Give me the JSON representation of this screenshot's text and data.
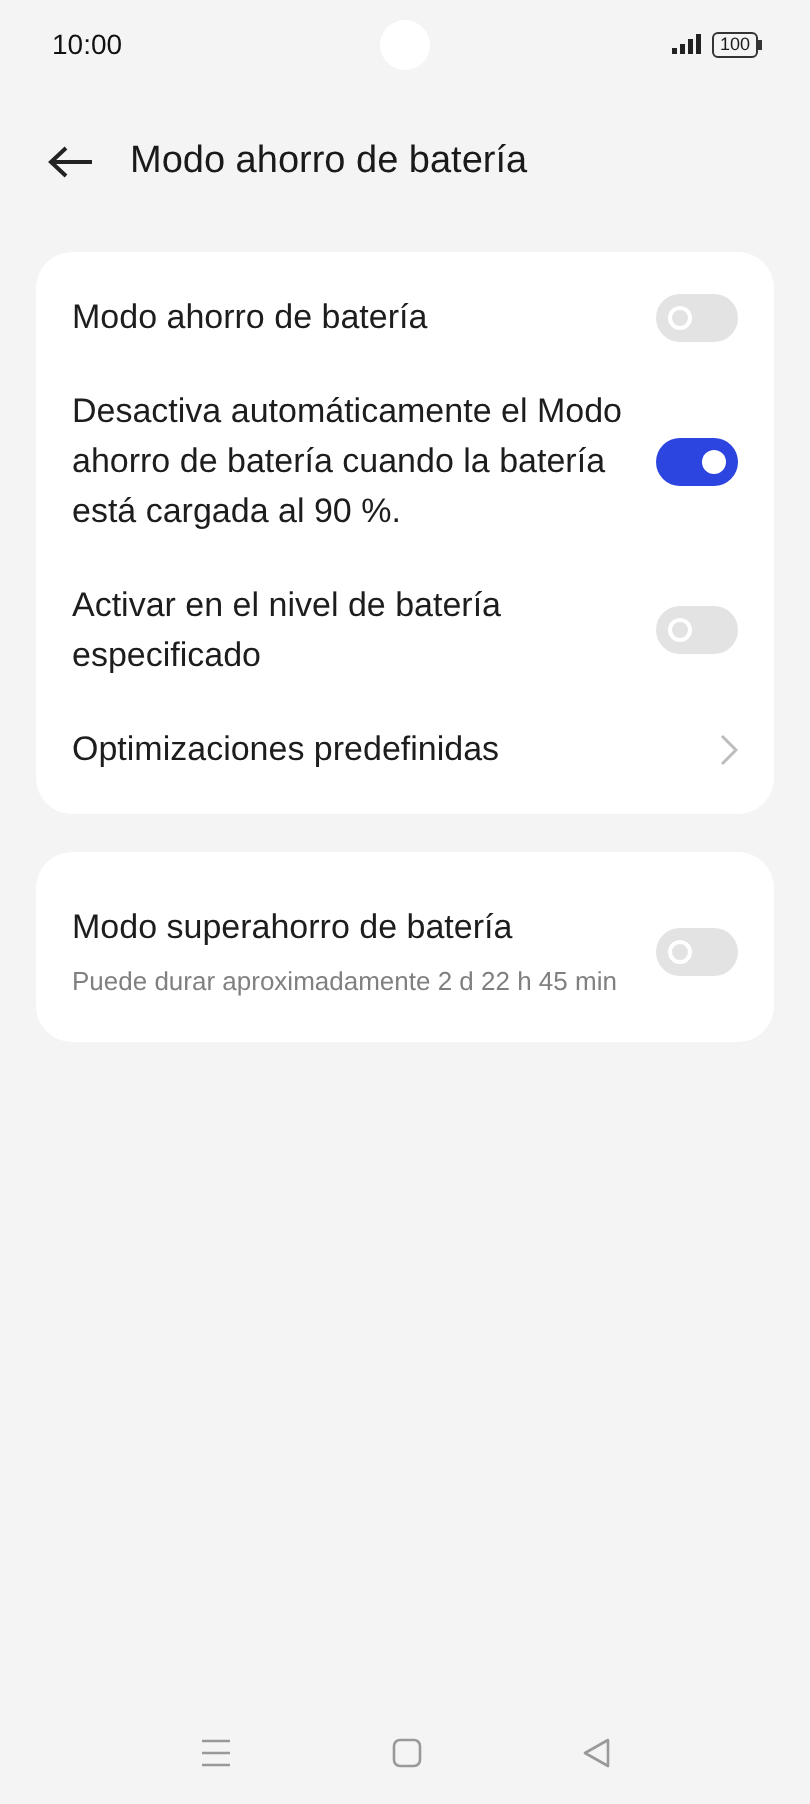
{
  "status_bar": {
    "time": "10:00",
    "battery": "100"
  },
  "header": {
    "title": "Modo ahorro de batería"
  },
  "sections": [
    {
      "items": [
        {
          "kind": "toggle",
          "label": "Modo ahorro de batería",
          "on": false
        },
        {
          "kind": "toggle",
          "label": "Desactiva automáticamente el Modo ahorro de batería cuando la batería está cargada al 90 %.",
          "on": true
        },
        {
          "kind": "toggle",
          "label": "Activar en el nivel de batería especificado",
          "on": false
        },
        {
          "kind": "link",
          "label": "Optimizaciones predefinidas"
        }
      ]
    },
    {
      "items": [
        {
          "kind": "toggle",
          "label": "Modo superahorro de batería",
          "subtitle": "Puede durar aproximadamente 2 d 22 h 45 min",
          "on": false
        }
      ]
    }
  ]
}
